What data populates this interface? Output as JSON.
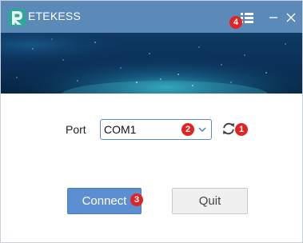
{
  "window": {
    "title": "ETEKESS"
  },
  "titlebar": {
    "icons": [
      "menu-icon",
      "minimize-icon",
      "close-icon"
    ]
  },
  "port": {
    "label": "Port",
    "selected": "COM1"
  },
  "buttons": {
    "connect_label": "Connect",
    "quit_label": "Quit"
  },
  "badges": {
    "refresh": "1",
    "port_select": "2",
    "connect": "3",
    "menu": "4"
  },
  "colors": {
    "titlebar": "#5b8ab8",
    "badge": "#e02424",
    "connect": "#5b8fd1",
    "quit": "#f0f0f0"
  }
}
